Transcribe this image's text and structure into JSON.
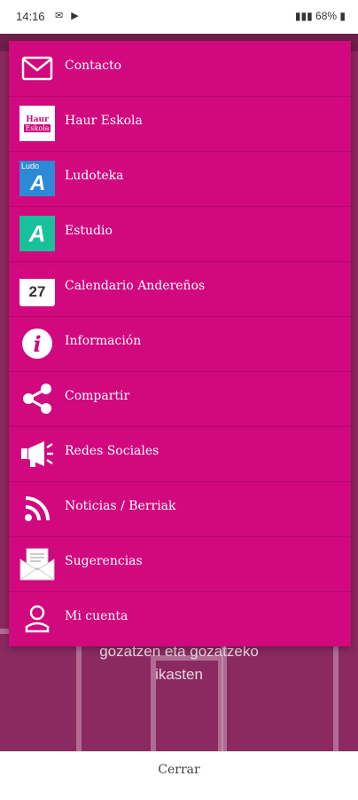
{
  "status_bar": {
    "time": "14:16",
    "battery": "68%"
  },
  "menu": {
    "items": [
      {
        "label": "Contacto",
        "icon": "mail-icon"
      },
      {
        "label": "Haur Eskola",
        "icon": "haur-eskola-logo"
      },
      {
        "label": "Ludoteka",
        "icon": "ludoteka-logo"
      },
      {
        "label": "Estudio",
        "icon": "estudio-logo"
      },
      {
        "label": "Calendario Andereños",
        "icon": "calendar-icon"
      },
      {
        "label": "Información",
        "icon": "info-icon"
      },
      {
        "label": "Compartir",
        "icon": "share-icon"
      },
      {
        "label": "Redes Sociales",
        "icon": "megaphone-icon"
      },
      {
        "label": "Noticias / Berriak",
        "icon": "rss-icon"
      },
      {
        "label": "Sugerencias",
        "icon": "envelope-letter-icon"
      },
      {
        "label": "Mi cuenta",
        "icon": "user-icon"
      }
    ]
  },
  "logos": {
    "haur_eskola_top": "Haur",
    "haur_eskola_bottom": "Eskola",
    "ludoteka_text": "Ludo",
    "calendar_day": "27"
  },
  "background": {
    "line1": "gozatzen eta gozatzeko",
    "line2": "ikasten"
  },
  "footer": {
    "close_label": "Cerrar"
  },
  "colors": {
    "menu_bg": "#d1087e",
    "accent": "#d1087e"
  }
}
